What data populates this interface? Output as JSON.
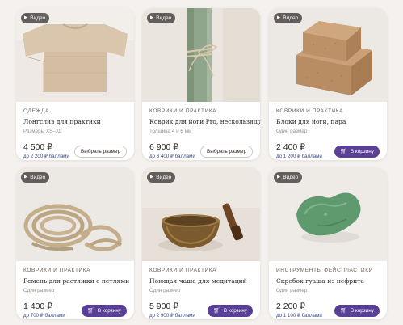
{
  "video_label": "Видео",
  "products": [
    {
      "category": "ОДЕЖДА",
      "name": "Лонгслив для практики",
      "detail": "Размеры XS–XL",
      "price": "4 500 ₽",
      "bonus": "до 2 200 ₽ баллами",
      "button": "Выбрать размер",
      "button_style": "outline"
    },
    {
      "category": "КОВРИКИ И ПРАКТИКА",
      "name": "Коврик для йоги Pro, нескользящий",
      "detail": "Толщина 4 и 6 мм",
      "price": "6 900 ₽",
      "bonus": "до 3 400 ₽ баллами",
      "button": "Выбрать размер",
      "button_style": "outline"
    },
    {
      "category": "КОВРИКИ И ПРАКТИКА",
      "name": "Блоки для йоги, пара",
      "detail": "Один размер",
      "price": "2 400 ₽",
      "bonus": "до 1 200 ₽ баллами",
      "button": "В корзину",
      "button_style": "filled"
    },
    {
      "category": "КОВРИКИ И ПРАКТИКА",
      "name": "Ремень для растяжки с петлями",
      "detail": "Один размер",
      "price": "1 400 ₽",
      "bonus": "до 700 ₽ баллами",
      "button": "В корзину",
      "button_style": "filled"
    },
    {
      "category": "КОВРИКИ И ПРАКТИКА",
      "name": "Поющая чаша для медитаций",
      "detail": "Один размер",
      "price": "5 900 ₽",
      "bonus": "до 2 900 ₽ баллами",
      "button": "В корзину",
      "button_style": "filled"
    },
    {
      "category": "ИНСТРУМЕНТЫ ФЕЙСПЛАСТИКИ",
      "name": "Скребок гуаша из нефрита",
      "detail": "Один размер",
      "price": "2 200 ₽",
      "bonus": "до 1 100 ₽ баллами",
      "button": "В корзину",
      "button_style": "filled"
    }
  ],
  "colors": {
    "accent": "#5a3f97",
    "bonus_text": "#3a4a8a",
    "page_bg": "#f4f1ee"
  },
  "icons": [
    "play-icon",
    "cart-icon"
  ]
}
